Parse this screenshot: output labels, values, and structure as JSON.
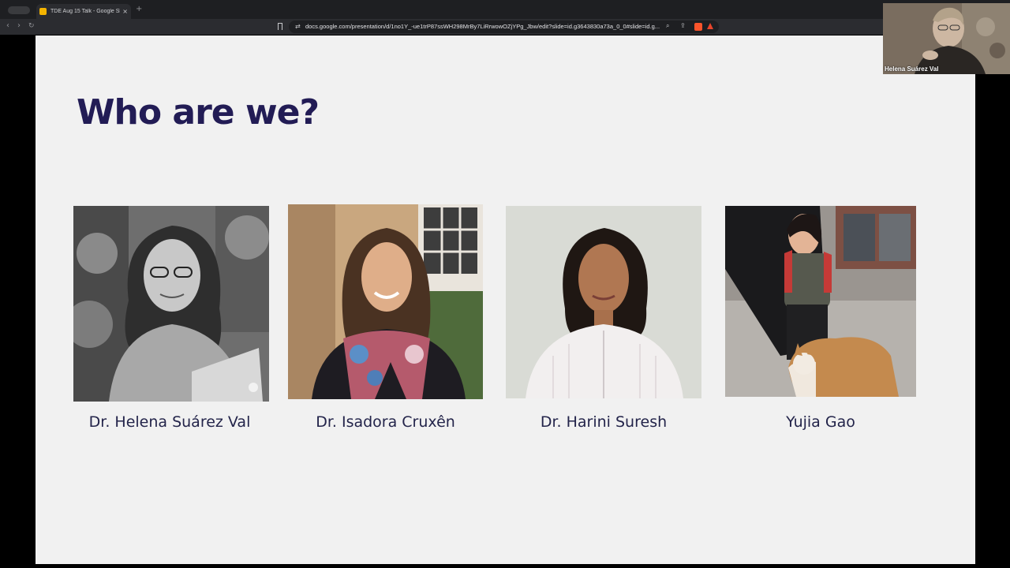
{
  "browser": {
    "tab": {
      "title": "TDE Aug 15 Talk - Google Slides",
      "close_icon": "×",
      "favicon": "google-slides-icon"
    },
    "new_tab_icon": "+",
    "nav": {
      "back": "‹",
      "forward": "›",
      "reload": "↻"
    },
    "url": "docs.google.com/presentation/d/1no1Y_-ue1trP87ssWH298MrBy7LiRrwowOZjYPg_Jbw/edit?slide=id.g3643830a73a_0_0#slide=id.g...",
    "colors": {
      "tabstrip": "#1e1f22",
      "toolbar": "#2b2c30"
    }
  },
  "slide": {
    "title": "Who are we?",
    "title_color": "#221c55",
    "background": "#f1f1f1",
    "people": [
      {
        "name": "Dr. Helena Suárez Val"
      },
      {
        "name": "Dr. Isadora Cruxên"
      },
      {
        "name": "Dr. Harini Suresh"
      },
      {
        "name": "Yujia Gao"
      }
    ]
  },
  "video_call": {
    "participant_name": "Helena Suárez Val"
  }
}
